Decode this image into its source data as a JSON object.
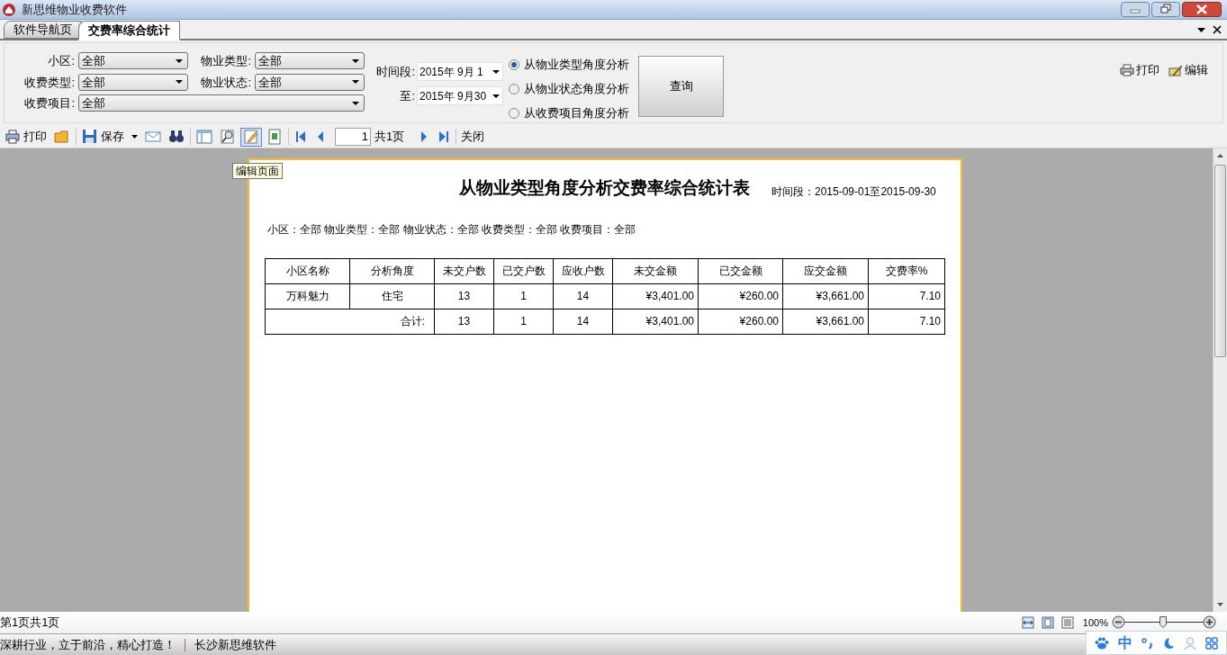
{
  "window": {
    "title": "新思维物业收费软件"
  },
  "tabs": [
    {
      "label": "软件导航页",
      "selected": false
    },
    {
      "label": "交费率综合统计",
      "selected": true
    }
  ],
  "filters": {
    "rows": [
      [
        {
          "label": "小区:",
          "value": "全部"
        },
        {
          "label": "物业类型:",
          "value": "全部"
        }
      ],
      [
        {
          "label": "收费类型:",
          "value": "全部"
        },
        {
          "label": "物业状态:",
          "value": "全部"
        }
      ],
      [
        {
          "label": "收费项目:",
          "value": "全部"
        }
      ]
    ],
    "dates": [
      {
        "label": "时间段:",
        "value": "2015年 9月 1"
      },
      {
        "label": "至:",
        "value": "2015年 9月30"
      }
    ],
    "analyses": [
      {
        "label": "从物业类型角度分析",
        "selected": true
      },
      {
        "label": "从物业状态角度分析",
        "selected": false
      },
      {
        "label": "从收费项目角度分析",
        "selected": false
      }
    ],
    "query_button": "查询",
    "actions": [
      "打印",
      "编辑"
    ]
  },
  "toolbar": {
    "buttons": [
      {
        "label": "打印",
        "selected": false
      },
      {
        "selected": false
      },
      {
        "label": "保存",
        "selected": false
      },
      {
        "selected": false
      },
      {
        "selected": false
      },
      {
        "selected": false
      },
      {
        "selected": false
      },
      {
        "selected": true
      },
      {
        "selected": false
      }
    ],
    "page": "1",
    "total": "共1页",
    "close": "关闭"
  },
  "tooltip": "编辑页面",
  "report": {
    "title": "从物业类型角度分析交费率综合统计表",
    "period": "时间段：2015-09-01至2015-09-30",
    "criteria": "小区：全部 物业类型：全部 物业状态：全部 收费类型：全部 收费项目：全部",
    "columns": [
      "小区名称",
      "分析角度",
      "未交户数",
      "已交户数",
      "应收户数",
      "未交金额",
      "已交金额",
      "应交金额",
      "交费率%"
    ],
    "rows": [
      [
        "万科魅力",
        "住宅",
        "13",
        "1",
        "14",
        "¥3,401.00",
        "¥260.00",
        "¥3,661.00",
        "7.10"
      ]
    ],
    "total": [
      "合计:",
      "13",
      "1",
      "14",
      "¥3,401.00",
      "¥260.00",
      "¥3,661.00",
      "7.10"
    ]
  },
  "status": {
    "page_info": "第1页共1页",
    "zoom": "100%",
    "level": 0.49
  },
  "footer": {
    "slogan": "深耕行业，立于前沿，精心打造！",
    "company": "长沙新思维软件",
    "ime": "中"
  }
}
